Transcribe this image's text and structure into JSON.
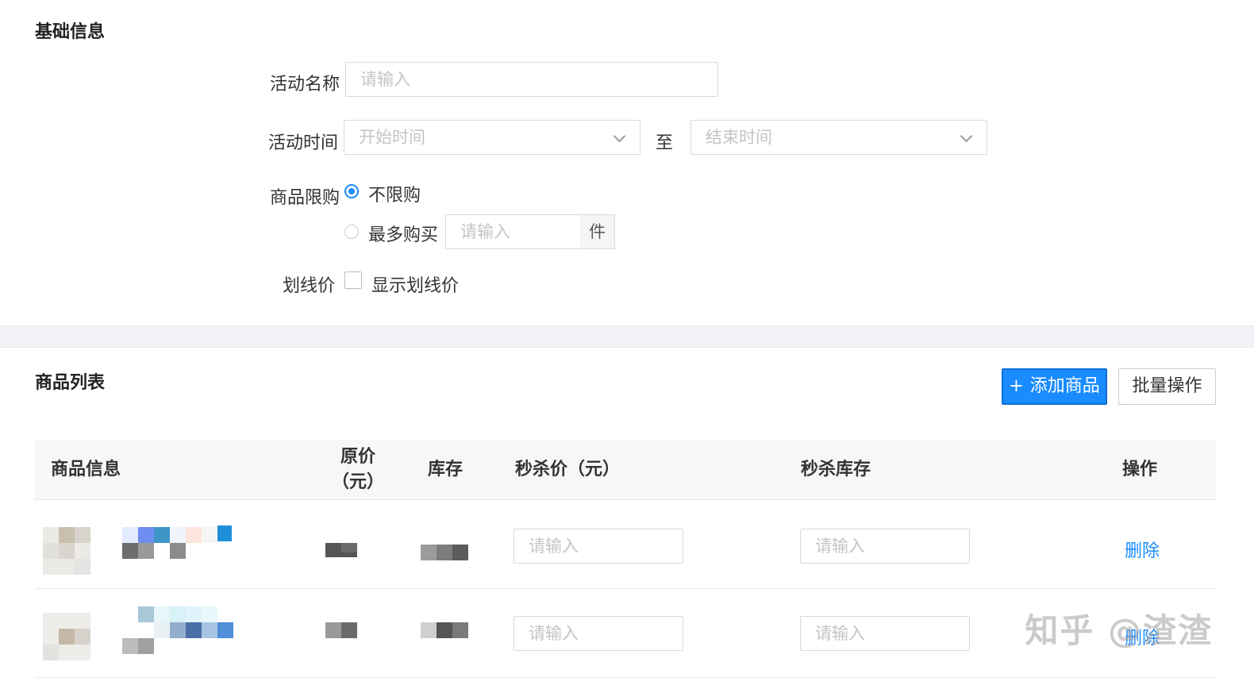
{
  "basic_info": {
    "section_title": "基础信息",
    "activity_name": {
      "label": "活动名称",
      "placeholder": "请输入"
    },
    "activity_time": {
      "label": "活动时间",
      "start_placeholder": "开始时间",
      "separator": "至",
      "end_placeholder": "结束时间"
    },
    "purchase_limit": {
      "label": "商品限购",
      "option_unlimited": "不限购",
      "option_max": "最多购买",
      "max_placeholder": "请输入",
      "unit": "件",
      "selected": "不限购"
    },
    "strike_price": {
      "label": "划线价",
      "checkbox_label": "显示划线价",
      "checked": false
    }
  },
  "product_list": {
    "section_title": "商品列表",
    "add_button": "添加商品",
    "add_button_icon": "plus-icon",
    "batch_button": "批量操作",
    "columns": {
      "info": "商品信息",
      "original_price_line1": "原价",
      "original_price_line2": "（元）",
      "stock": "库存",
      "flash_price": "秒杀价（元）",
      "flash_stock": "秒杀库存",
      "action": "操作"
    },
    "rows": [
      {
        "flash_price_placeholder": "请输入",
        "flash_stock_placeholder": "请输入",
        "action": "删除"
      },
      {
        "flash_price_placeholder": "请输入",
        "flash_stock_placeholder": "请输入",
        "action": "删除"
      }
    ]
  },
  "watermark": "知乎 @渣渣",
  "colors": {
    "primary": "#1a8cff",
    "band": "#f0f2f5",
    "header_bg": "#f7f7f7"
  }
}
